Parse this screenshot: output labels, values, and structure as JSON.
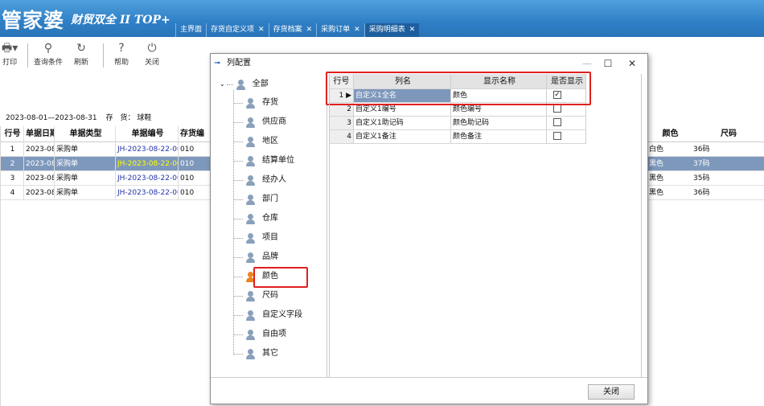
{
  "app": {
    "logo": "管家婆",
    "logo_sub": "财贸双全 II TOP+"
  },
  "tabs": [
    {
      "label": "主界面",
      "closable": false
    },
    {
      "label": "存货自定义项",
      "closable": true
    },
    {
      "label": "存货档案",
      "closable": true
    },
    {
      "label": "采购订单",
      "closable": true
    },
    {
      "label": "采购明细表",
      "closable": true,
      "active": true
    }
  ],
  "toolbar": {
    "print": "打印",
    "query": "查询条件",
    "refresh": "刷新",
    "help": "帮助",
    "close": "关闭"
  },
  "filter": {
    "date_range": "2023-08-01—2023-08-31",
    "label": "存　货：",
    "value": "球鞋"
  },
  "list": {
    "headers": [
      "行号",
      "单据日期",
      "单据类型",
      "单据编号",
      "存货编"
    ],
    "rows": [
      [
        "1",
        "2023-08-",
        "采购单",
        "JH-2023-08-22-00",
        "010"
      ],
      [
        "2",
        "2023-08-",
        "采购单",
        "JH-2023-08-22-00",
        "010"
      ],
      [
        "3",
        "2023-08-",
        "采购单",
        "JH-2023-08-22-00",
        "010"
      ],
      [
        "4",
        "2023-08-",
        "采购单",
        "JH-2023-08-22-00",
        "010"
      ]
    ],
    "right_headers": [
      "颜色",
      "尺码"
    ],
    "right_rows": [
      [
        "白色",
        "36码"
      ],
      [
        "黑色",
        "37码"
      ],
      [
        "黑色",
        "35码"
      ],
      [
        "黑色",
        "36码"
      ]
    ]
  },
  "dialog": {
    "title": "列配置",
    "tree_root": "全部",
    "tree_items": [
      "存货",
      "供应商",
      "地区",
      "结算单位",
      "经办人",
      "部门",
      "仓库",
      "项目",
      "品牌",
      "颜色",
      "尺码",
      "自定义字段",
      "自由项",
      "其它"
    ],
    "selected_item": "颜色",
    "grid_headers": [
      "行号",
      "列名",
      "显示名称",
      "是否显示"
    ],
    "grid_rows": [
      {
        "no": "1",
        "name": "自定义1全名",
        "display": "颜色",
        "show": true
      },
      {
        "no": "2",
        "name": "自定义1编号",
        "display": "颜色编号",
        "show": false
      },
      {
        "no": "3",
        "name": "自定义1助记码",
        "display": "颜色助记码",
        "show": false
      },
      {
        "no": "4",
        "name": "自定义1备注",
        "display": "颜色备注",
        "show": false
      }
    ],
    "close_label": "关闭"
  },
  "colors": {
    "banner": "#2f7fc6",
    "selection": "#7e98bc",
    "highlight_box": "#e02020"
  }
}
